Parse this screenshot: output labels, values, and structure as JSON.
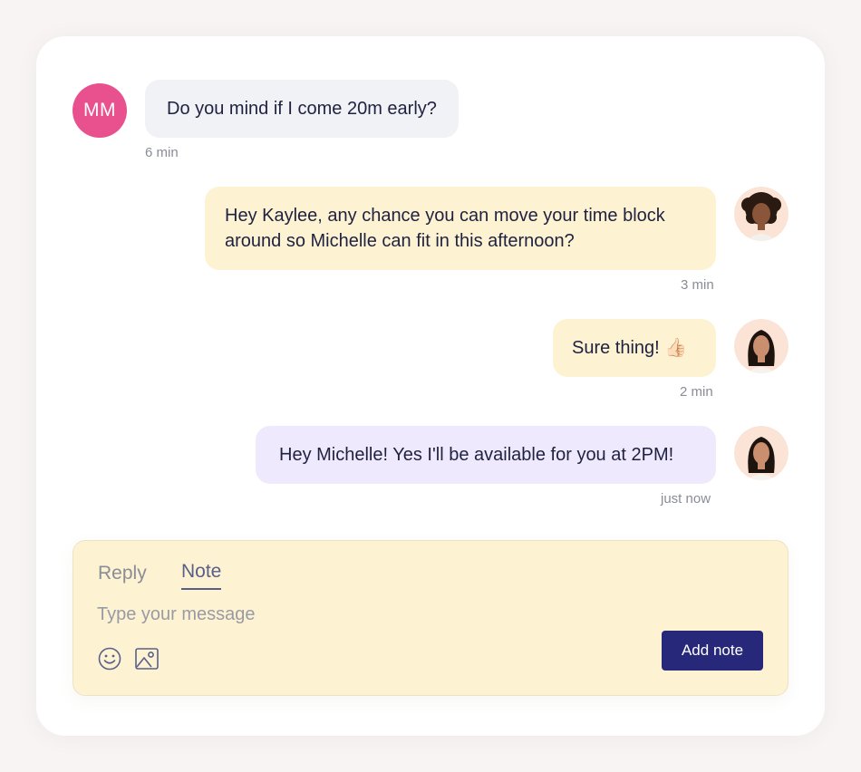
{
  "messages": [
    {
      "sender": "MM",
      "text": "Do you mind if I come 20m early?",
      "time": "6 min",
      "avatar_color": "#e8508e"
    },
    {
      "text": "Hey Kaylee, any chance you can move your time block",
      "text_line2": "around so Michelle can fit in this afternoon?",
      "time": "3 min"
    },
    {
      "text": "Sure thing!",
      "emoji": "👍🏻",
      "time": "2 min"
    },
    {
      "text": "Hey Michelle! Yes I'll be available for you at 2PM!",
      "time": "just now"
    }
  ],
  "composer": {
    "tabs": {
      "reply": "Reply",
      "note": "Note"
    },
    "active_tab": "Note",
    "placeholder": "Type your message",
    "value": "",
    "add_note_label": "Add note",
    "icons": [
      "smiley-icon",
      "image-icon"
    ]
  },
  "colors": {
    "accent": "#27287a",
    "initials_avatar": "#e8508e",
    "bubble_gray": "#f1f2f6",
    "bubble_yellow": "#fdf3d3",
    "bubble_purple": "#efe9fd"
  }
}
